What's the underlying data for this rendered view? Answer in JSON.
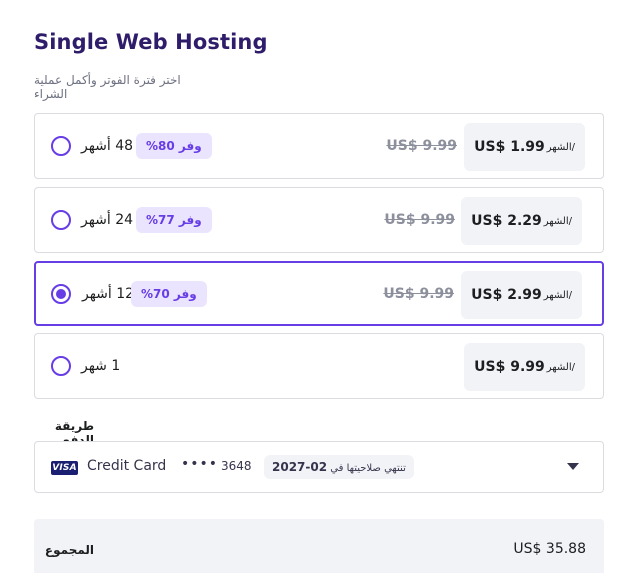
{
  "page": {
    "title": "Single Web Hosting",
    "subtitle": "اختر فترة الفوتر وأكمل عملية الشراء"
  },
  "plans": [
    {
      "period": "48 أشهر",
      "badge": "وفر 80%",
      "old_price": "US$ 9.99",
      "per": "/الشهر",
      "price": "US$ 1.99",
      "selected": false
    },
    {
      "period": "24 أشهر",
      "badge": "وفر 77%",
      "old_price": "US$ 9.99",
      "per": "/الشهر",
      "price": "US$ 2.29",
      "selected": false
    },
    {
      "period": "12 أشهر",
      "badge": "وفر 70%",
      "old_price": "US$ 9.99",
      "per": "/الشهر",
      "price": "US$ 2.99",
      "selected": true
    },
    {
      "period": "1 شهر",
      "per": "/الشهر",
      "price": "US$ 9.99",
      "selected": false
    }
  ],
  "payment": {
    "label": "طريقة الدفع",
    "card_brand": "VISA",
    "card_name": "Credit Card",
    "card_dots": "••••",
    "last4": "3648",
    "expiry_prefix": "تنتهي صلاحيتها في",
    "expiry_date": "02-2027"
  },
  "total": {
    "label": "المجموع",
    "value": "US$ 35.88"
  },
  "colors": {
    "accent": "#673de6",
    "badge_bg": "#ebe4ff",
    "panel_bg": "#f2f3f6",
    "border": "#dadce0"
  },
  "icons": {
    "radio": "radio-circle",
    "dropdown": "chevron-down-icon",
    "card": "visa-logo"
  }
}
